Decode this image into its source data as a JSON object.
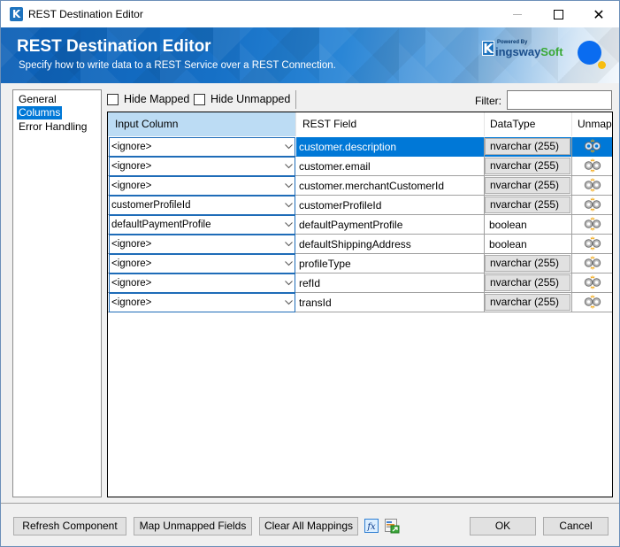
{
  "window": {
    "title": "REST Destination Editor",
    "app_icon": "K",
    "controls": [
      "minimize",
      "maximize",
      "close"
    ]
  },
  "banner": {
    "title": "REST Destination Editor",
    "subtitle": "Specify how to write data to a REST Service over a REST Connection.",
    "brand_powered": "Powered By",
    "brand_k": "K",
    "brand_name_part1": "ingsway",
    "brand_name_part2": "Soft",
    "colors": {
      "dot_blue": "#0a6cf0",
      "dot_yellow": "#f7bd0f"
    }
  },
  "nav": {
    "items": [
      {
        "label": "General",
        "selected": false
      },
      {
        "label": "Columns",
        "selected": true
      },
      {
        "label": "Error Handling",
        "selected": false
      }
    ]
  },
  "toolbar": {
    "hide_mapped_label": "Hide Mapped",
    "hide_mapped_checked": false,
    "hide_unmapped_label": "Hide Unmapped",
    "hide_unmapped_checked": false,
    "filter_label": "Filter:",
    "filter_value": ""
  },
  "grid": {
    "columns": [
      "Input Column",
      "REST Field",
      "DataType",
      "Unmap"
    ],
    "rows": [
      {
        "input": "<ignore>",
        "rest_field": "customer.description",
        "data_type": "nvarchar (255)",
        "type_boxed": true,
        "selected": true
      },
      {
        "input": "<ignore>",
        "rest_field": "customer.email",
        "data_type": "nvarchar (255)",
        "type_boxed": true,
        "selected": false
      },
      {
        "input": "<ignore>",
        "rest_field": "customer.merchantCustomerId",
        "data_type": "nvarchar (255)",
        "type_boxed": true,
        "selected": false
      },
      {
        "input": "customerProfileId",
        "rest_field": "customerProfileId",
        "data_type": "nvarchar (255)",
        "type_boxed": true,
        "selected": false
      },
      {
        "input": "defaultPaymentProfile",
        "rest_field": "defaultPaymentProfile",
        "data_type": "boolean",
        "type_boxed": false,
        "selected": false
      },
      {
        "input": "<ignore>",
        "rest_field": "defaultShippingAddress",
        "data_type": "boolean",
        "type_boxed": false,
        "selected": false
      },
      {
        "input": "<ignore>",
        "rest_field": "profileType",
        "data_type": "nvarchar (255)",
        "type_boxed": true,
        "selected": false
      },
      {
        "input": "<ignore>",
        "rest_field": "refId",
        "data_type": "nvarchar (255)",
        "type_boxed": true,
        "selected": false
      },
      {
        "input": "<ignore>",
        "rest_field": "transId",
        "data_type": "nvarchar (255)",
        "type_boxed": true,
        "selected": false
      }
    ]
  },
  "buttons": {
    "refresh": "Refresh Component",
    "map_unmapped": "Map Unmapped Fields",
    "clear_all": "Clear All Mappings",
    "ok": "OK",
    "cancel": "Cancel"
  },
  "colors": {
    "selection": "#0078d7",
    "header_active": "#bcdcf4",
    "brand_blue": "#1e73be",
    "brand_green": "#39a935"
  }
}
